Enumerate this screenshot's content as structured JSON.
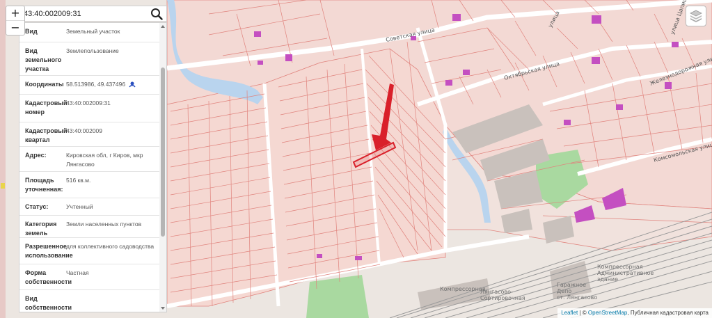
{
  "search": {
    "value": "43:40:002009:31"
  },
  "zoom": {
    "plus": "+",
    "minus": "−"
  },
  "details": [
    {
      "key": "Вид",
      "value": "Земельный участок"
    },
    {
      "key": "Вид земельного участка",
      "value": "Землепользование"
    },
    {
      "key": "Координаты",
      "value": "58.513986, 49.437496"
    },
    {
      "key": "Кадастровый номер",
      "value": "43:40:002009:31"
    },
    {
      "key": "Кадастровый квартал",
      "value": "43:40:002009"
    },
    {
      "key": "Адрес:",
      "value": "Кировская обл, г Киров, мкр Лянгасово"
    },
    {
      "key": "Площадь уточненная:",
      "value": "516 кв.м."
    },
    {
      "key": "Статус:",
      "value": "Учтенный"
    },
    {
      "key": "Категория земель",
      "value": "Земли населенных пунктов"
    },
    {
      "key": "Разрешенное использование",
      "value": "для коллективного садоводства"
    },
    {
      "key": "Форма собственности",
      "value": "Частная"
    },
    {
      "key": "Вид собственности",
      "value": ""
    }
  ],
  "streets": {
    "sovetskaya": "Советская улица",
    "oktyabrskaya": "Октябрьская улица",
    "komsomolskaya": "Комсомольская улица",
    "zheleznodorozhnaya": "Железнодорожная улица",
    "top_right_1": "улица",
    "top_right_2": "улица Цапиц"
  },
  "pois": {
    "kompressornaya": "Компрессорная",
    "station": "Лянгасово-\nСортировочная",
    "depot": "Гаражное\nДепо",
    "depot2": "ст. Лянгасово",
    "admin": "Компрессорная\nАдминистративное\nздание"
  },
  "attribution": {
    "leaflet": "Leaflet",
    "sep": " | © ",
    "osm": "OpenStreetMap",
    "rest": ", Публичная кадастровая карта"
  },
  "colors": {
    "parcel_line": "#e0837d",
    "parcel_fill": "#f3d9d4",
    "highlight": "#d9202a",
    "building": "#c44fc1",
    "water": "#b9d4ee",
    "green": "#a9d9a0",
    "rail": "#9b9b9b"
  }
}
